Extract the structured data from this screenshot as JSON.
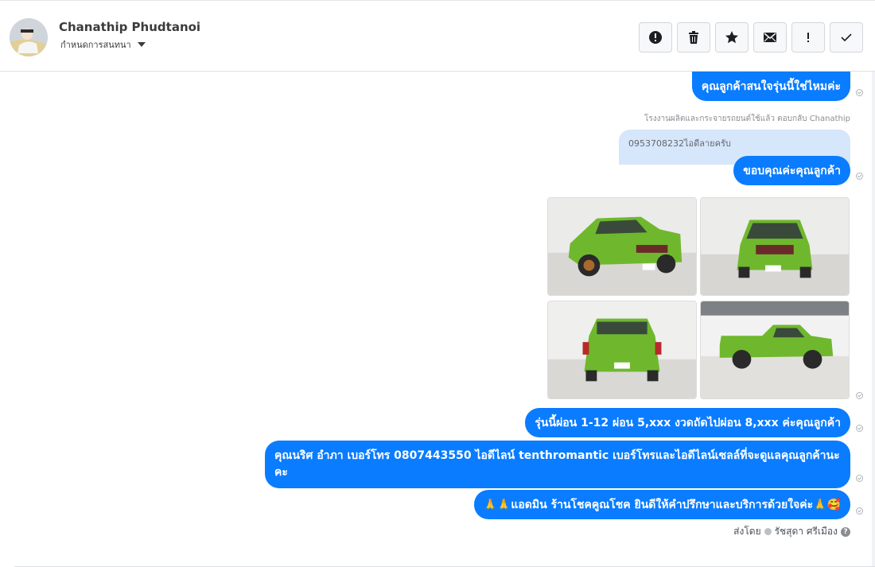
{
  "header": {
    "name": "Chanathip Phudtanoi",
    "assign_label": "กำหนดการสนทนา"
  },
  "messages": {
    "m1": "คุณลูกค้าสนใจรุ่นนี้ใช่ไหมค่ะ",
    "reply_label": "โรงงานผลิตและกระจายรถยนต์ใช้แล้ว ตอบกลับ Chanathip",
    "quoted_text": "0953708232ไอดีลายครับ",
    "m2": "ขอบคุณค่ะคุณลูกค้า",
    "m3": "รุ่นนี้ผ่อน 1-12 ผ่อน 5,xxx งวดถัดไปผ่อน 8,xxx ค่ะคุณลูกค้า",
    "m4": "คุณนริศ อำภา  เบอร์โทร 0807443550  ไอดีไลน์ tenthromantic   เบอร์โทรและไอดีไลน์เซลล์ที่จะดูแลคุณลูกค้านะคะ",
    "m5_emoji_left": "🙏🙏",
    "m5_text": "แอดมิน ร้านโชคคูณโชค ยินดีให้คำปรึกษาและบริการด้วยใจค่ะ",
    "m5_emoji_right": "🙏🥰"
  },
  "sent_by": {
    "label": "ส่งโดย",
    "agent": "รัชสุดา ศรีเมือง"
  },
  "photos": [
    {
      "name": "green-pickup-front-left",
      "car_color": "#6fb82d"
    },
    {
      "name": "green-pickup-front",
      "car_color": "#6fb82d"
    },
    {
      "name": "green-pickup-rear",
      "car_color": "#6fb82d"
    },
    {
      "name": "green-pickup-side",
      "car_color": "#6fb82d"
    }
  ],
  "colors": {
    "bubble": "#0a7cff",
    "quoted_bg": "#d6e6fb"
  },
  "icons": [
    "alert-circle-icon",
    "trash-icon",
    "star-icon",
    "envelope-icon",
    "exclamation-icon",
    "checkmark-icon",
    "caret-down-icon",
    "help-icon",
    "seen-check-icon"
  ]
}
